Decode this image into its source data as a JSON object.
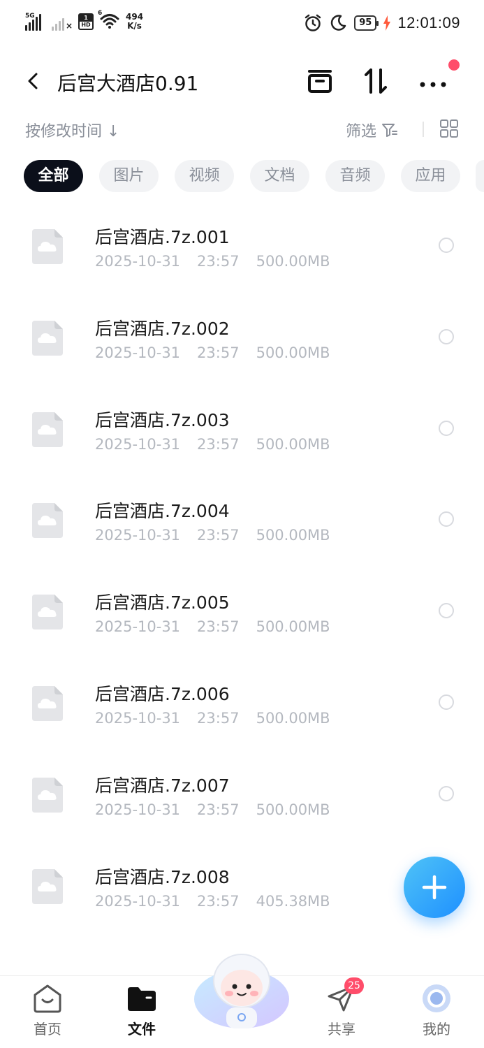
{
  "status_bar": {
    "sim1_label": "5G",
    "hd_top": "1",
    "hd_bottom": "HD",
    "wifi_label": "6",
    "speed_value": "494",
    "speed_unit": "K/s",
    "battery": "95",
    "time": "12:01:09"
  },
  "header": {
    "title": "后宫大酒店0.91"
  },
  "toolbar": {
    "sort_label": "按修改时间",
    "sort_arrow": "↓",
    "filter_label": "筛选"
  },
  "tabs": [
    {
      "label": "全部",
      "active": true
    },
    {
      "label": "图片",
      "active": false
    },
    {
      "label": "视频",
      "active": false
    },
    {
      "label": "文档",
      "active": false
    },
    {
      "label": "音频",
      "active": false
    },
    {
      "label": "应用",
      "active": false
    }
  ],
  "files": [
    {
      "name": "后宫酒店.7z.001",
      "date": "2025-10-31",
      "time": "23:57",
      "size": "500.00MB"
    },
    {
      "name": "后宫酒店.7z.002",
      "date": "2025-10-31",
      "time": "23:57",
      "size": "500.00MB"
    },
    {
      "name": "后宫酒店.7z.003",
      "date": "2025-10-31",
      "time": "23:57",
      "size": "500.00MB"
    },
    {
      "name": "后宫酒店.7z.004",
      "date": "2025-10-31",
      "time": "23:57",
      "size": "500.00MB"
    },
    {
      "name": "后宫酒店.7z.005",
      "date": "2025-10-31",
      "time": "23:57",
      "size": "500.00MB"
    },
    {
      "name": "后宫酒店.7z.006",
      "date": "2025-10-31",
      "time": "23:57",
      "size": "500.00MB"
    },
    {
      "name": "后宫酒店.7z.007",
      "date": "2025-10-31",
      "time": "23:57",
      "size": "500.00MB"
    },
    {
      "name": "后宫酒店.7z.008",
      "date": "2025-10-31",
      "time": "23:57",
      "size": "405.38MB"
    }
  ],
  "bottom_nav": {
    "home": "首页",
    "files": "文件",
    "share": "共享",
    "share_badge": "25",
    "mine": "我的"
  },
  "colors": {
    "accent": "#1e90ff",
    "badge": "#ff4d6a",
    "active_tab": "#0b0f1a"
  }
}
